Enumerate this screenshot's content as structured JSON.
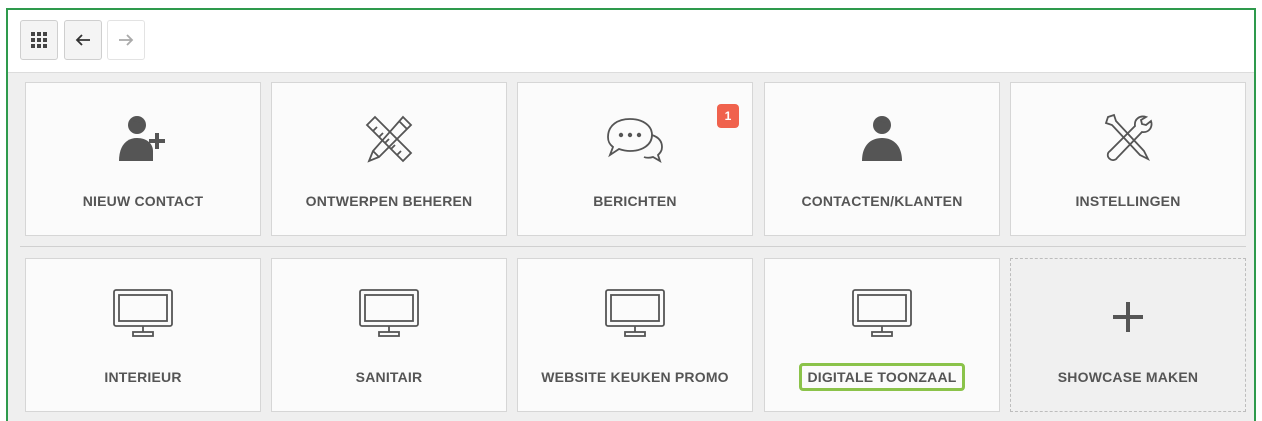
{
  "toolbar": {
    "apps_icon": "apps-grid-icon",
    "back_icon": "arrow-left-icon",
    "forward_icon": "arrow-right-icon"
  },
  "tiles_row1": [
    {
      "label": "NIEUW CONTACT",
      "icon": "add-user-icon"
    },
    {
      "label": "ONTWERPEN BEHEREN",
      "icon": "pencil-ruler-icon"
    },
    {
      "label": "BERICHTEN",
      "icon": "chat-bubbles-icon",
      "badge": "1"
    },
    {
      "label": "CONTACTEN/KLANTEN",
      "icon": "user-icon"
    },
    {
      "label": "INSTELLINGEN",
      "icon": "tools-icon"
    }
  ],
  "tiles_row2": [
    {
      "label": "INTERIEUR",
      "icon": "monitor-icon"
    },
    {
      "label": "SANITAIR",
      "icon": "monitor-icon"
    },
    {
      "label": "WEBSITE KEUKEN PROMO",
      "icon": "monitor-icon"
    },
    {
      "label": "DIGITALE TOONZAAL",
      "icon": "monitor-icon",
      "highlighted": true
    },
    {
      "label": "SHOWCASE MAKEN",
      "icon": "plus-icon"
    }
  ],
  "colors": {
    "frame_border": "#2e9a4c",
    "badge": "#f0624d",
    "highlight": "#8bc34a"
  }
}
